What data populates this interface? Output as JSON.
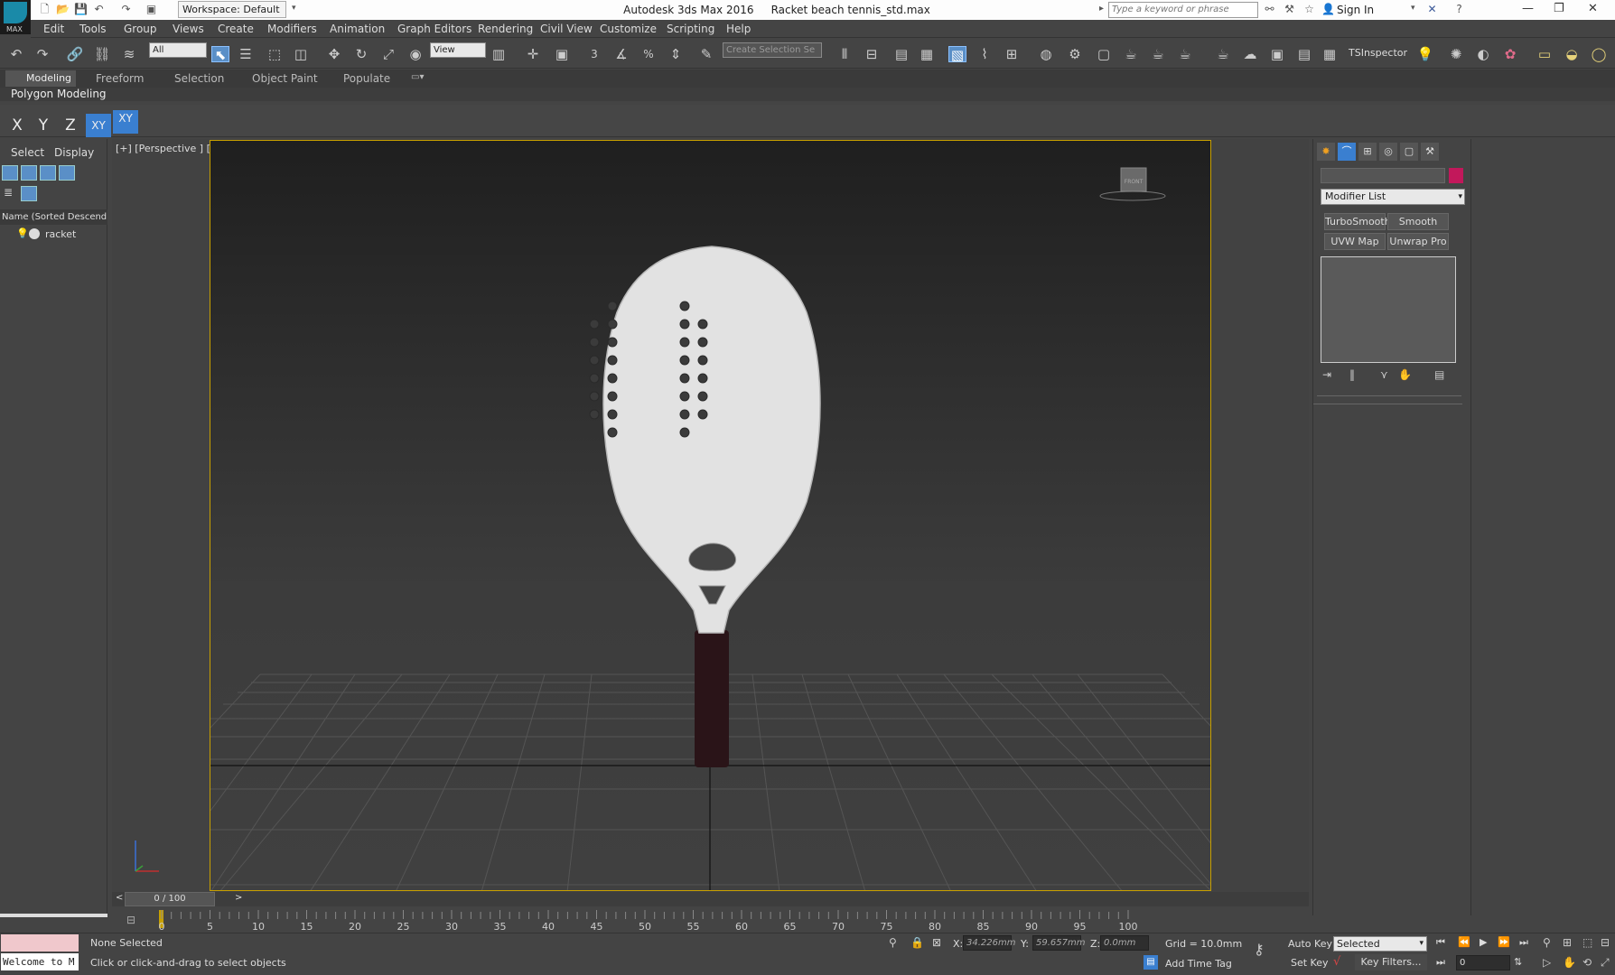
{
  "titlebar": {
    "workspace": "Workspace: Default",
    "app_title": "Autodesk 3ds Max 2016",
    "file_name": "Racket beach tennis_std.max",
    "search_placeholder": "Type a keyword or phrase",
    "sign_in": "Sign In",
    "logo_text": "MAX"
  },
  "menu": [
    "Edit",
    "Tools",
    "Group",
    "Views",
    "Create",
    "Modifiers",
    "Animation",
    "Graph Editors",
    "Rendering",
    "Civil View",
    "Customize",
    "Scripting",
    "Help"
  ],
  "toolbar": {
    "filter_value": "All",
    "refcoord_value": "View",
    "selection_set_placeholder": "Create Selection Se",
    "snap_label": "3",
    "percent_snap": "%",
    "ts_inspector": "TSInspector"
  },
  "ribbon": {
    "tabs": [
      "Modeling",
      "Freeform",
      "Selection",
      "Object Paint",
      "Populate"
    ],
    "panel_label": "Polygon Modeling"
  },
  "axis_constraints": [
    "X",
    "Y",
    "Z",
    "XY",
    "XY"
  ],
  "scene_explorer": {
    "tabs": [
      "Select",
      "Display"
    ],
    "column_header": "Name (Sorted Descending",
    "items": [
      "racket"
    ]
  },
  "viewport": {
    "label": "[+] [Perspective ] [Realistic ]",
    "viewcube_label": "FRONT"
  },
  "command_panel": {
    "modifier_list": "Modifier List",
    "modifier_buttons": [
      "TurboSmooth",
      "Smooth",
      "UVW Map",
      "Unwrap Pro"
    ]
  },
  "timeline": {
    "frame_counter": "0 / 100",
    "prev": "<",
    "next": ">",
    "ticks": [
      "0",
      "5",
      "10",
      "15",
      "20",
      "25",
      "30",
      "35",
      "40",
      "45",
      "50",
      "55",
      "60",
      "65",
      "70",
      "75",
      "80",
      "85",
      "90",
      "95",
      "100"
    ]
  },
  "status": {
    "listener": "Welcome to M",
    "selection": "None Selected",
    "prompt": "Click or click-and-drag to select objects",
    "x_label": "X:",
    "x_value": "34.226mm",
    "y_label": "Y:",
    "y_value": "59.657mm",
    "z_label": "Z:",
    "z_value": "0.0mm",
    "grid": "Grid = 10.0mm",
    "add_time_tag": "Add Time Tag",
    "auto_key": "Auto Key",
    "set_key": "Set Key",
    "key_mode": "Selected",
    "key_filters": "Key Filters...",
    "frame_value": "0"
  },
  "colors": {
    "object_color": "#c2185b",
    "viewport_border": "#c8a000",
    "selected_tool": "#5a8fc7"
  }
}
